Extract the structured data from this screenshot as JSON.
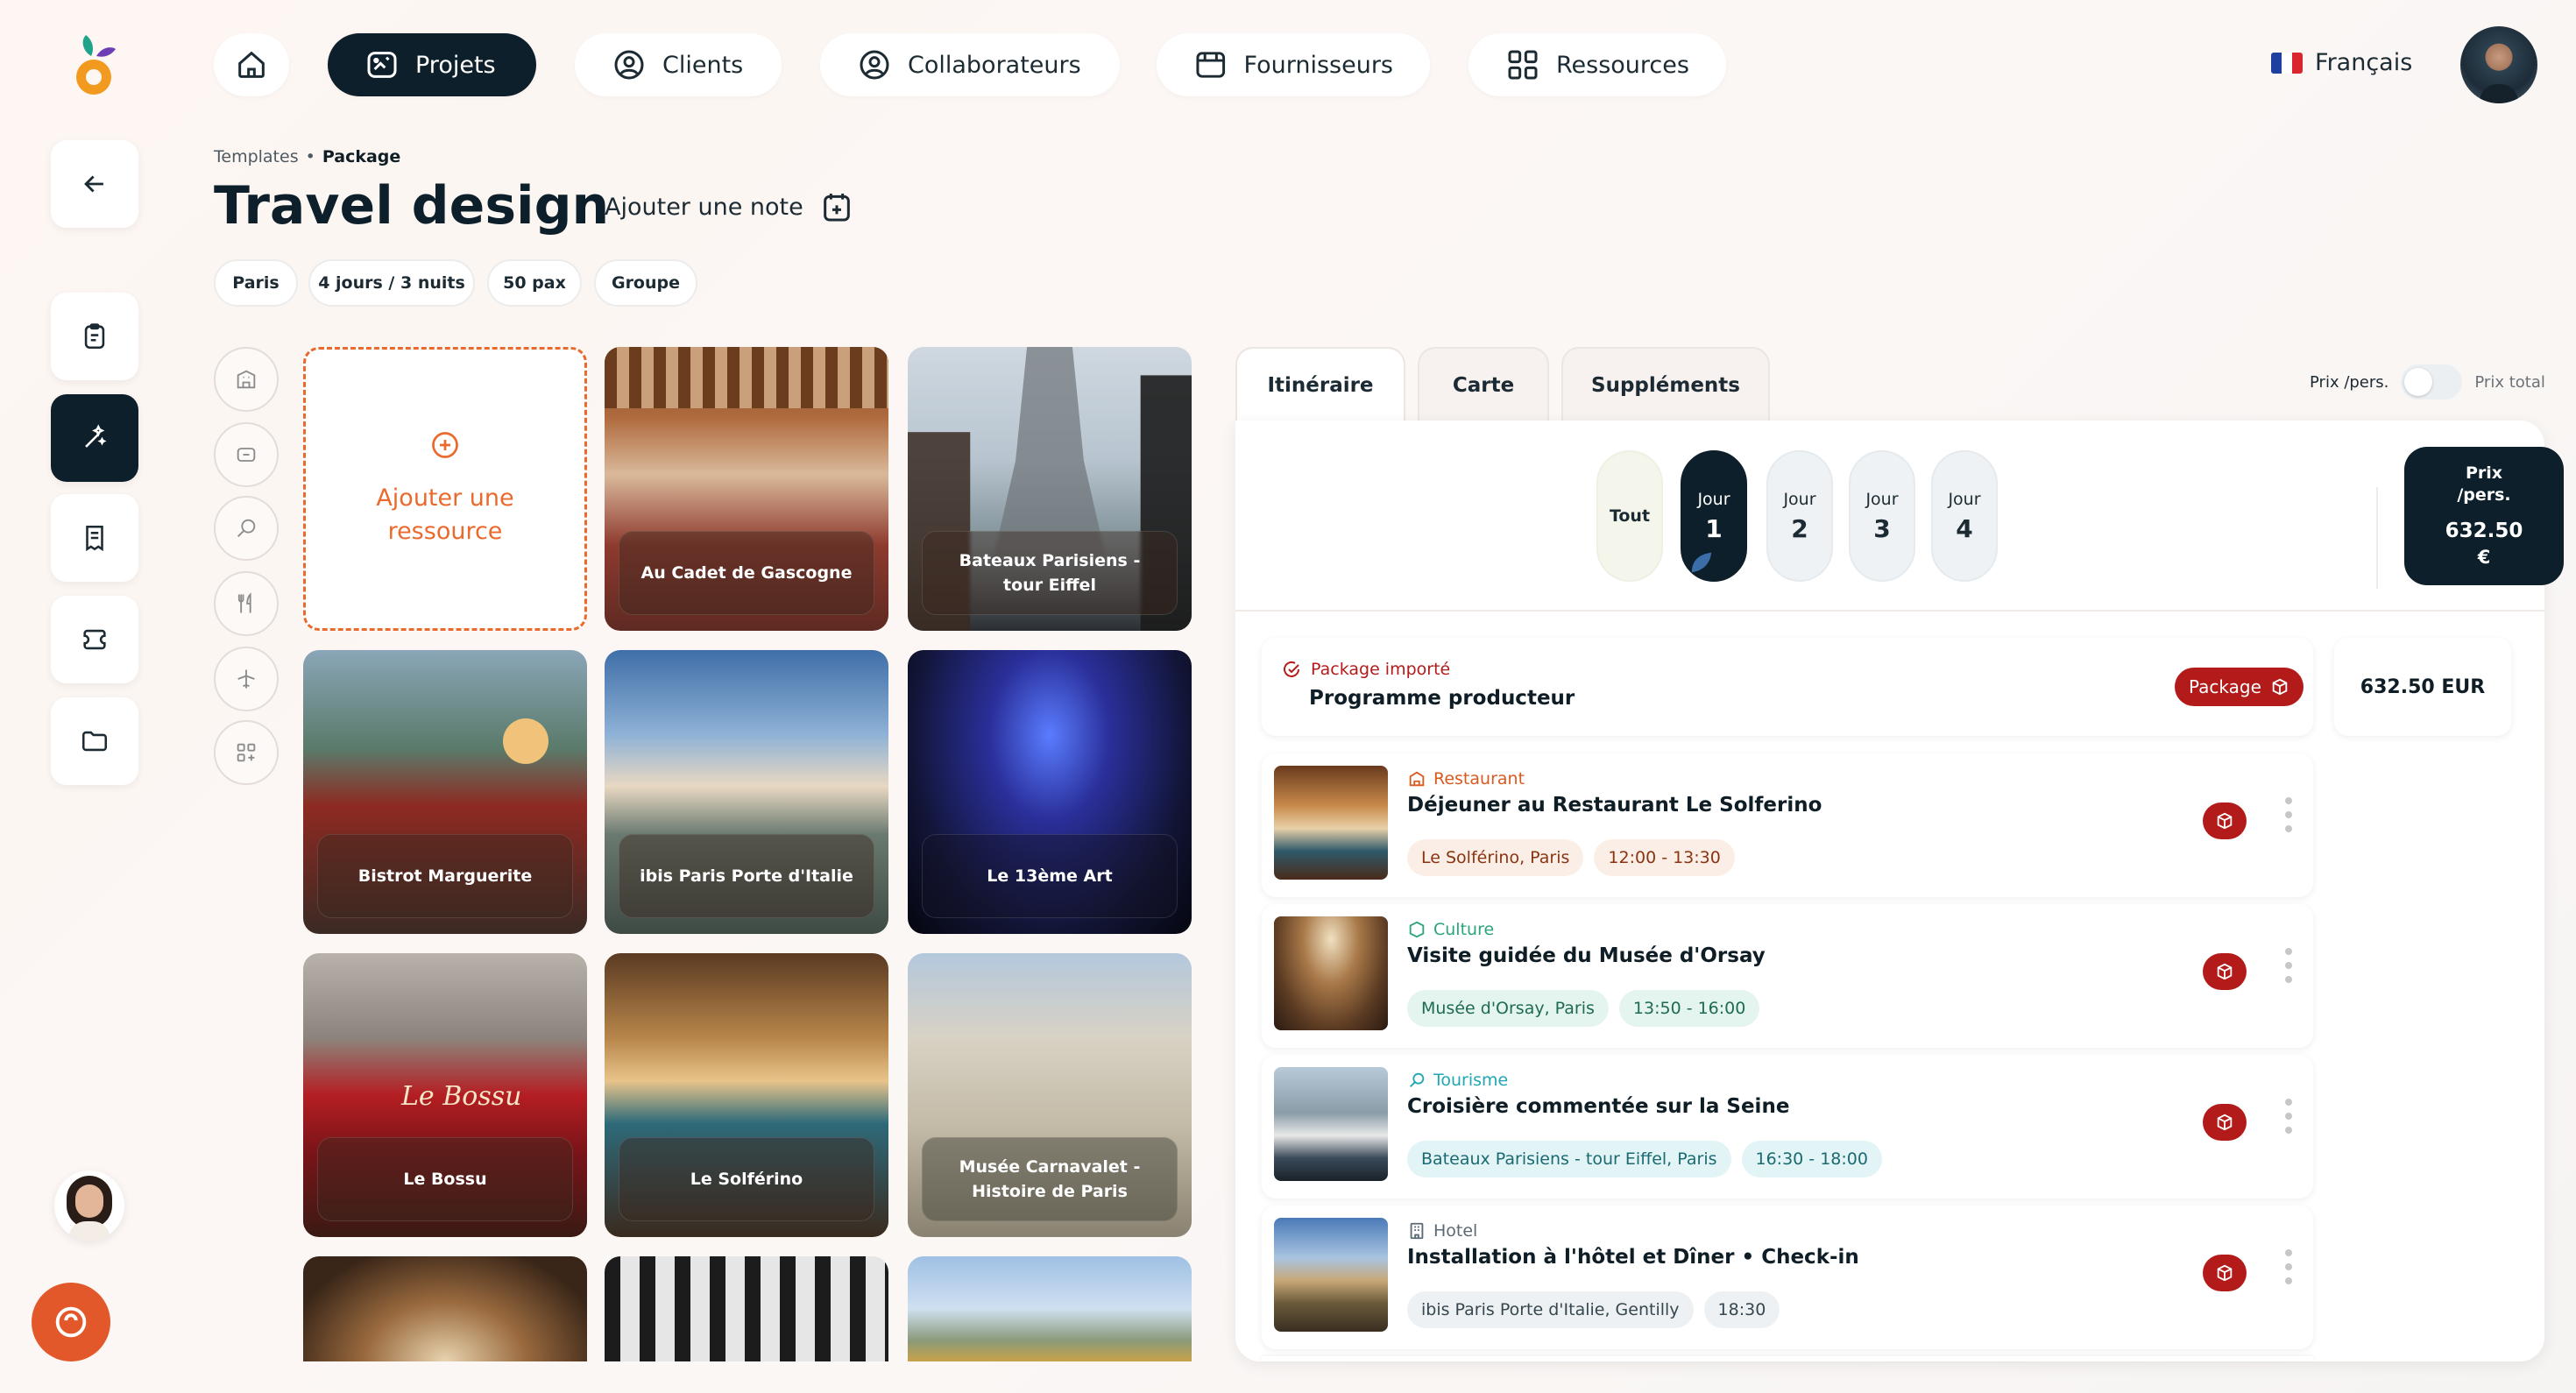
{
  "nav": {
    "items": [
      {
        "label": "Projets"
      },
      {
        "label": "Clients"
      },
      {
        "label": "Collaborateurs"
      },
      {
        "label": "Fournisseurs"
      },
      {
        "label": "Ressources"
      }
    ],
    "language": "Français"
  },
  "breadcrumb": {
    "parent": "Templates",
    "current": "Package"
  },
  "page": {
    "title": "Travel design",
    "add_note": "Ajouter une note"
  },
  "tags": [
    "Paris",
    "4 jours / 3 nuits",
    "50 pax",
    "Groupe"
  ],
  "resources": {
    "add_label": "Ajouter une ressource",
    "cards": [
      "Au Cadet de Gascogne",
      "Bateaux Parisiens - tour Eiffel",
      "Bistrot Marguerite",
      "ibis Paris Porte d'Italie",
      "Le 13ème Art",
      "Le Bossu",
      "Le Solférino",
      "Musée Carnavalet - Histoire de Paris"
    ]
  },
  "tabs": [
    "Itinéraire",
    "Carte",
    "Suppléments"
  ],
  "price_toggle": {
    "left": "Prix /pers.",
    "right": "Prix total"
  },
  "days": {
    "all": "Tout",
    "day_word": "Jour",
    "numbers": [
      "1",
      "2",
      "3",
      "4"
    ],
    "selected": 1
  },
  "price_box": {
    "line1": "Prix",
    "line2": "/pers.",
    "value": "632.50",
    "currency": "€"
  },
  "package": {
    "status": "Package importé",
    "name": "Programme producteur",
    "badge": "Package",
    "total": "632.50 EUR"
  },
  "itinerary": [
    {
      "category": "Restaurant",
      "title": "Déjeuner au Restaurant Le Solferino",
      "place": "Le Solférino, Paris",
      "time": "12:00 - 13:30",
      "color": "#d9591f",
      "chip_bg": "#fbeee6",
      "chip_fg": "#8a3412"
    },
    {
      "category": "Culture",
      "title": "Visite guidée du Musée d'Orsay",
      "place": "Musée d'Orsay, Paris",
      "time": "13:50 - 16:00",
      "color": "#2aa57a",
      "chip_bg": "#e4f4ee",
      "chip_fg": "#1e6b51"
    },
    {
      "category": "Tourisme",
      "title": "Croisière commentée sur la Seine",
      "place": "Bateaux Parisiens - tour Eiffel, Paris",
      "time": "16:30 - 18:00",
      "color": "#1fa7b3",
      "chip_bg": "#e2f4f5",
      "chip_fg": "#1a6a72"
    },
    {
      "category": "Hotel",
      "title": "Installation à l'hôtel et Dîner • Check-in",
      "place": "ibis Paris Porte d'Italie, Gentilly",
      "time": "18:30",
      "color": "#5a6a74",
      "chip_bg": "#edf1f3",
      "chip_fg": "#37474f"
    }
  ],
  "colors": {
    "dark": "#0d1f2a",
    "accent": "#e96a2c",
    "package_red": "#b31b1b"
  }
}
